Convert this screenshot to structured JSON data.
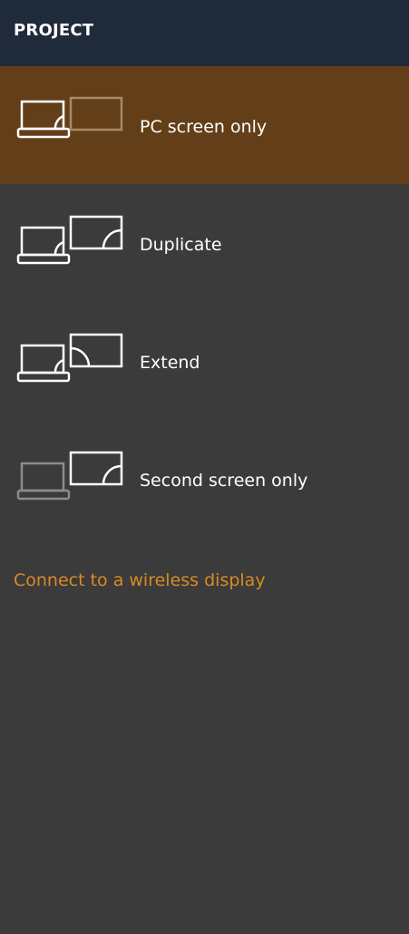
{
  "header": {
    "title": "PROJECT"
  },
  "options": [
    {
      "label": "PC screen only",
      "icon": "pc-screen-only-icon",
      "selected": true
    },
    {
      "label": "Duplicate",
      "icon": "duplicate-icon",
      "selected": false
    },
    {
      "label": "Extend",
      "icon": "extend-icon",
      "selected": false
    },
    {
      "label": "Second screen only",
      "icon": "second-screen-only-icon",
      "selected": false
    }
  ],
  "wireless_link": {
    "label": "Connect to a wireless display"
  },
  "colors": {
    "background": "#3b3b3b",
    "header": "#1f2a3a",
    "selected": "#633f19",
    "accent": "#d98a25"
  }
}
